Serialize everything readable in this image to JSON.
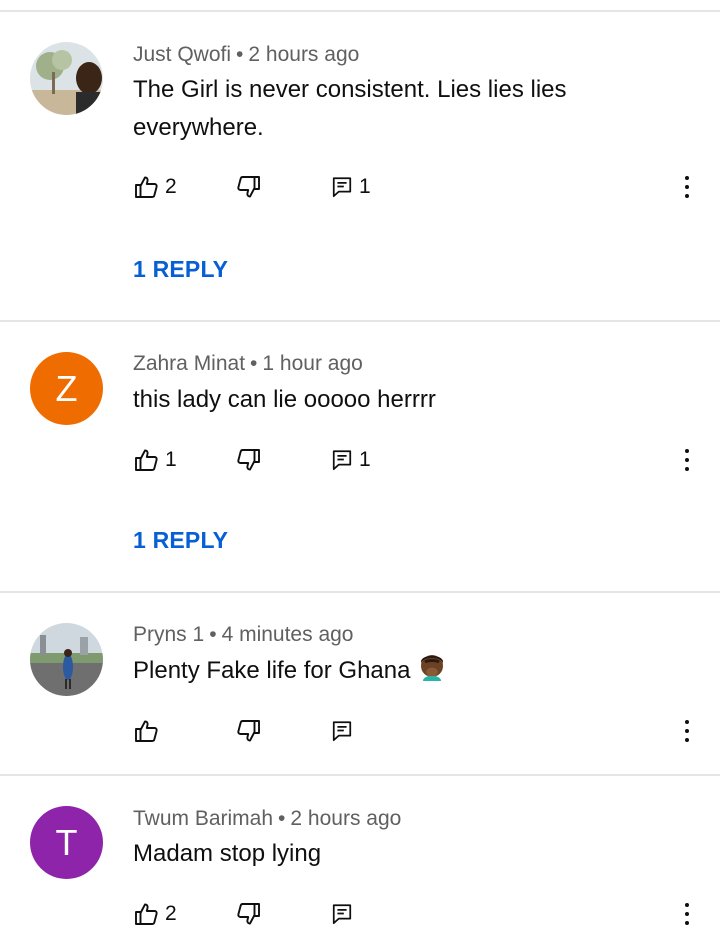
{
  "comments": [
    {
      "author": "Just Qwofi",
      "separator": "•",
      "time": "2 hours ago",
      "text": "The Girl is never consistent. Lies lies lies everywhere.",
      "likes": "2",
      "replies_count": "1",
      "reply_link": "1 REPLY",
      "avatar_type": "photo"
    },
    {
      "author": "Zahra Minat",
      "separator": "•",
      "time": "1 hour ago",
      "text": "this lady can lie ooooo herrrr",
      "likes": "1",
      "replies_count": "1",
      "reply_link": "1 REPLY",
      "avatar_type": "letter",
      "avatar_letter": "Z",
      "avatar_color": "#ef6c00"
    },
    {
      "author": "Pryns 1",
      "separator": "•",
      "time": "4 minutes ago",
      "text": "Plenty Fake life for Ghana",
      "emoji": "face-palm-emoji",
      "likes": "",
      "replies_count": "",
      "avatar_type": "photo"
    },
    {
      "author": "Twum Barimah",
      "separator": "•",
      "time": "2 hours ago",
      "text": "Madam stop lying",
      "likes": "2",
      "replies_count": "",
      "avatar_type": "letter",
      "avatar_letter": "T",
      "avatar_color": "#8e24aa"
    }
  ],
  "icons": {
    "like": "thumbs-up-icon",
    "dislike": "thumbs-down-icon",
    "reply": "comment-icon",
    "more": "more-vertical-icon"
  },
  "colors": {
    "link": "#065fd4",
    "meta_text": "#606060",
    "divider": "#e5e5e5"
  }
}
